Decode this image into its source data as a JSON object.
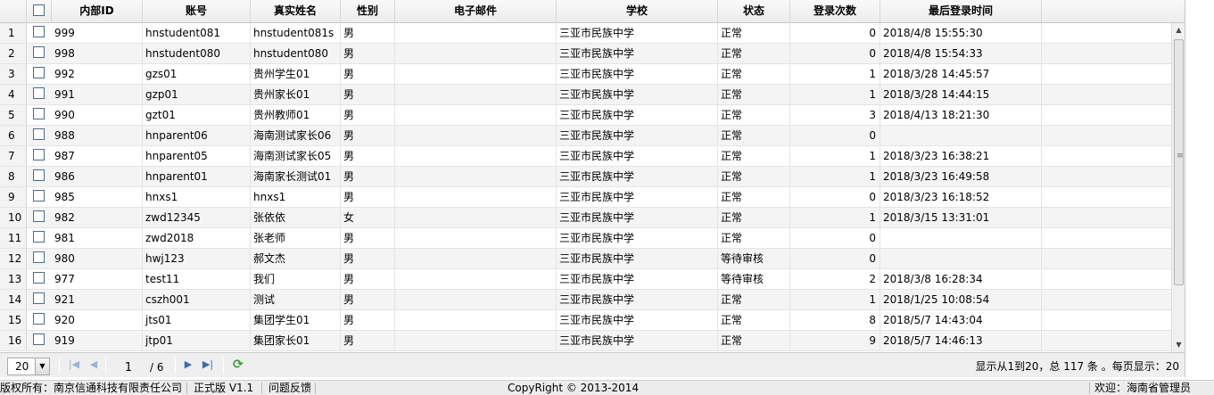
{
  "table": {
    "columns": [
      "内部ID",
      "账号",
      "真实姓名",
      "性别",
      "电子邮件",
      "学校",
      "状态",
      "登录次数",
      "最后登录时间"
    ],
    "rows": [
      {
        "num": "1",
        "id": "999",
        "account": "hnstudent081",
        "name": "hnstudent081s",
        "gender": "男",
        "email": "",
        "school": "三亚市民族中学",
        "status": "正常",
        "logins": "0",
        "last_login": "2018/4/8 15:55:30"
      },
      {
        "num": "2",
        "id": "998",
        "account": "hnstudent080",
        "name": "hnstudent080",
        "gender": "男",
        "email": "",
        "school": "三亚市民族中学",
        "status": "正常",
        "logins": "0",
        "last_login": "2018/4/8 15:54:33"
      },
      {
        "num": "3",
        "id": "992",
        "account": "gzs01",
        "name": "贵州学生01",
        "gender": "男",
        "email": "",
        "school": "三亚市民族中学",
        "status": "正常",
        "logins": "1",
        "last_login": "2018/3/28 14:45:57"
      },
      {
        "num": "4",
        "id": "991",
        "account": "gzp01",
        "name": "贵州家长01",
        "gender": "男",
        "email": "",
        "school": "三亚市民族中学",
        "status": "正常",
        "logins": "1",
        "last_login": "2018/3/28 14:44:15"
      },
      {
        "num": "5",
        "id": "990",
        "account": "gzt01",
        "name": "贵州教师01",
        "gender": "男",
        "email": "",
        "school": "三亚市民族中学",
        "status": "正常",
        "logins": "3",
        "last_login": "2018/4/13 18:21:30"
      },
      {
        "num": "6",
        "id": "988",
        "account": "hnparent06",
        "name": "海南测试家长06",
        "gender": "男",
        "email": "",
        "school": "三亚市民族中学",
        "status": "正常",
        "logins": "0",
        "last_login": ""
      },
      {
        "num": "7",
        "id": "987",
        "account": "hnparent05",
        "name": "海南测试家长05",
        "gender": "男",
        "email": "",
        "school": "三亚市民族中学",
        "status": "正常",
        "logins": "1",
        "last_login": "2018/3/23 16:38:21"
      },
      {
        "num": "8",
        "id": "986",
        "account": "hnparent01",
        "name": "海南家长测试01",
        "gender": "男",
        "email": "",
        "school": "三亚市民族中学",
        "status": "正常",
        "logins": "1",
        "last_login": "2018/3/23 16:49:58"
      },
      {
        "num": "9",
        "id": "985",
        "account": "hnxs1",
        "name": "hnxs1",
        "gender": "男",
        "email": "",
        "school": "三亚市民族中学",
        "status": "正常",
        "logins": "0",
        "last_login": "2018/3/23 16:18:52"
      },
      {
        "num": "10",
        "id": "982",
        "account": "zwd12345",
        "name": "张依依",
        "gender": "女",
        "email": "",
        "school": "三亚市民族中学",
        "status": "正常",
        "logins": "1",
        "last_login": "2018/3/15 13:31:01"
      },
      {
        "num": "11",
        "id": "981",
        "account": "zwd2018",
        "name": "张老师",
        "gender": "男",
        "email": "",
        "school": "三亚市民族中学",
        "status": "正常",
        "logins": "0",
        "last_login": ""
      },
      {
        "num": "12",
        "id": "980",
        "account": "hwj123",
        "name": "郝文杰",
        "gender": "男",
        "email": "",
        "school": "三亚市民族中学",
        "status": "等待审核",
        "logins": "0",
        "last_login": ""
      },
      {
        "num": "13",
        "id": "977",
        "account": "test11",
        "name": "我们",
        "gender": "男",
        "email": "",
        "school": "三亚市民族中学",
        "status": "等待审核",
        "logins": "2",
        "last_login": "2018/3/8 16:28:34"
      },
      {
        "num": "14",
        "id": "921",
        "account": "cszh001",
        "name": "测试",
        "gender": "男",
        "email": "",
        "school": "三亚市民族中学",
        "status": "正常",
        "logins": "1",
        "last_login": "2018/1/25 10:08:54"
      },
      {
        "num": "15",
        "id": "920",
        "account": "jts01",
        "name": "集团学生01",
        "gender": "男",
        "email": "",
        "school": "三亚市民族中学",
        "status": "正常",
        "logins": "8",
        "last_login": "2018/5/7 14:43:04"
      },
      {
        "num": "16",
        "id": "919",
        "account": "jtp01",
        "name": "集团家长01",
        "gender": "男",
        "email": "",
        "school": "三亚市民族中学",
        "status": "正常",
        "logins": "9",
        "last_login": "2018/5/7 14:46:13"
      }
    ]
  },
  "pager": {
    "page_size": "20",
    "current_page": "1",
    "total_pages": "/ 6",
    "info": "显示从1到20，总 117 条 。每页显示：20"
  },
  "footer": {
    "copyright_owner": "版权所有：南京信通科技有限责任公司",
    "version": "正式版 V1.1",
    "feedback": "问题反馈",
    "copyright": "CopyRight © 2013-2014",
    "welcome": "欢迎：海南省管理员"
  },
  "icons": {
    "first": "first-page-icon",
    "prev": "prev-page-icon",
    "next": "next-page-icon",
    "last": "last-page-icon",
    "refresh": "refresh-icon"
  },
  "colors": {
    "pager_icon": "#3d6bb5",
    "refresh_icon": "#3e9b3a"
  }
}
